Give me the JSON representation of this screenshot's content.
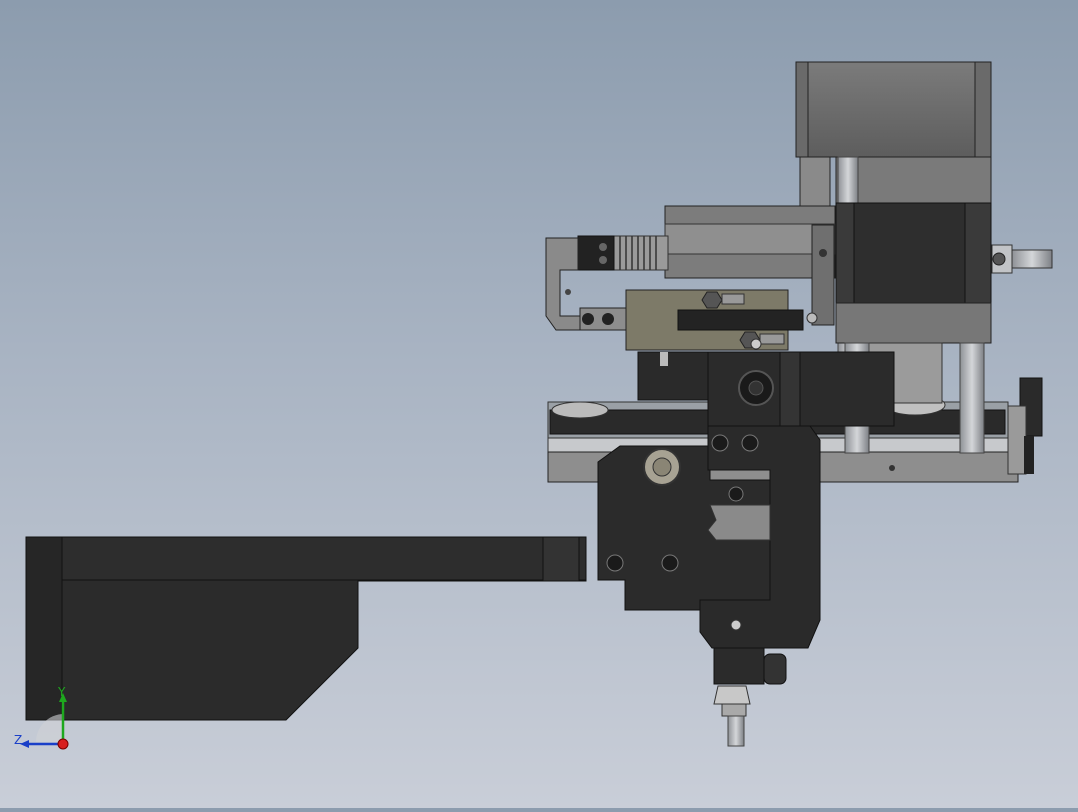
{
  "viewport": {
    "background_top": "#8c9cae",
    "background_bottom": "#c9ced8",
    "part_colors": {
      "dark": "#2b2b2b",
      "black": "#1e1e1e",
      "mid_gray": "#6f6f6f",
      "light_gray": "#9a9a9a",
      "steel": "#b9bcc0",
      "olive": "#7d7a68",
      "edge": "#111111"
    }
  },
  "triad": {
    "y_label": "Y",
    "z_label": "Z",
    "y_color": "#1ea81e",
    "z_color": "#1a3fc8",
    "x_color": "#d81e1e"
  }
}
